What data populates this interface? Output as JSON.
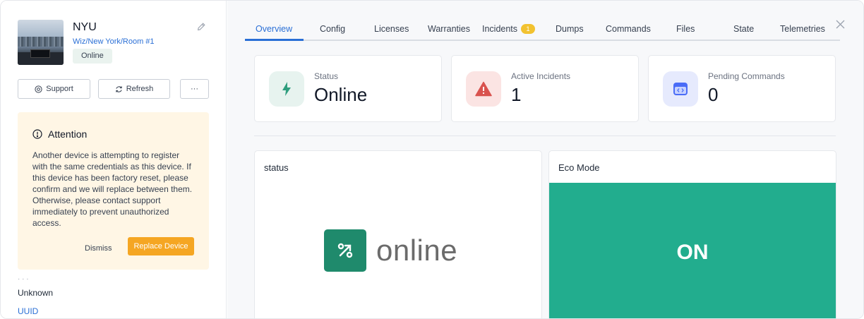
{
  "device": {
    "name": "NYU",
    "path": "Wiz/New York/Room #1",
    "status": "Online"
  },
  "actions": {
    "support_label": "Support",
    "refresh_label": "Refresh",
    "more_label": "···"
  },
  "alert": {
    "title": "Attention",
    "body": "Another device is attempting to register with the same credentials as this device. If this device has been factory reset, please confirm and we will replace between them. Otherwise, please contact support immediately to prevent unauthorized access.",
    "dismiss_label": "Dismiss",
    "replace_label": "Replace Device"
  },
  "info": {
    "cut_label": "· · ·",
    "value": "Unknown",
    "uuid_label": "UUID"
  },
  "tabs": [
    {
      "label": "Overview"
    },
    {
      "label": "Config"
    },
    {
      "label": "Licenses"
    },
    {
      "label": "Warranties"
    },
    {
      "label": "Incidents",
      "badge": "1"
    },
    {
      "label": "Dumps"
    },
    {
      "label": "Commands"
    },
    {
      "label": "Files"
    },
    {
      "label": "State"
    },
    {
      "label": "Telemetries"
    }
  ],
  "summary": {
    "status": {
      "label": "Status",
      "value": "Online",
      "icon": "bolt-icon",
      "color": "#2f9e7e"
    },
    "incidents": {
      "label": "Active Incidents",
      "value": "1",
      "icon": "warning-icon",
      "color": "#d9534f"
    },
    "commands": {
      "label": "Pending Commands",
      "value": "0",
      "icon": "code-window-icon",
      "color": "#4a6cf7"
    }
  },
  "panels": {
    "status": {
      "title": "status",
      "logo_text": "online"
    },
    "eco": {
      "title": "Eco Mode",
      "value": "ON",
      "color": "#22ad8e"
    }
  }
}
